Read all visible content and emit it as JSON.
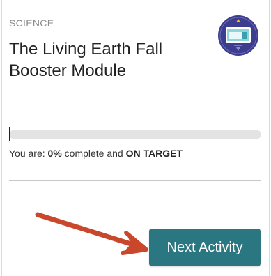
{
  "card": {
    "subject": "SCIENCE",
    "title": "The Living Earth Fall Booster Module",
    "status": {
      "prefix": "You are: ",
      "percent_text": "0%",
      "middle": " complete and ",
      "target_text": "ON TARGET"
    },
    "progress": {
      "value": 0
    },
    "next_button_label": "Next Activity",
    "badge_icon": "classroom-screen-icon"
  },
  "colors": {
    "accent": "#2a7781",
    "annotation_arrow": "#c9472b",
    "badge_bg": "#3d3d8f",
    "progress_track": "#e3e3e3"
  }
}
